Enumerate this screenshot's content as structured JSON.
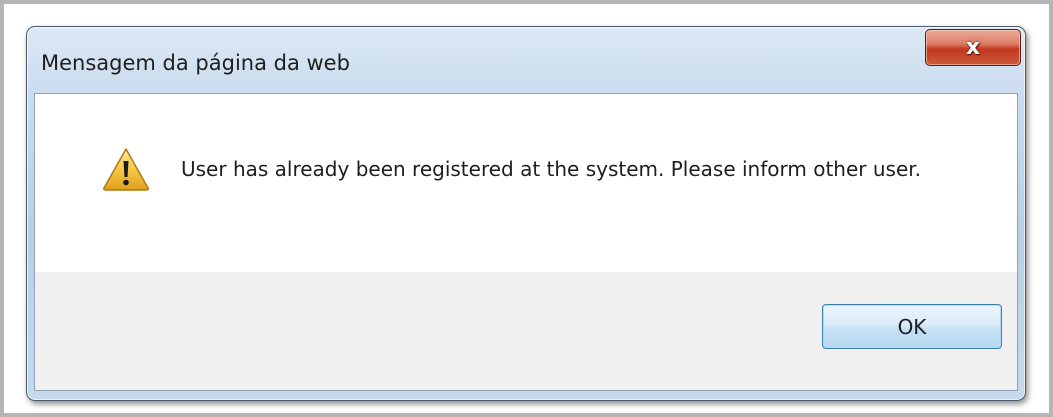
{
  "dialog": {
    "title": "Mensagem da página da web",
    "close_icon": "close-icon",
    "close_glyph": "x",
    "message": "User has already been registered at the system. Please inform other user.",
    "message_icon": "warning-icon",
    "ok_label": "OK"
  },
  "colors": {
    "close_button": "#c2381f",
    "ok_border": "#3c7fb1",
    "warning_fill": "#f6c744"
  }
}
